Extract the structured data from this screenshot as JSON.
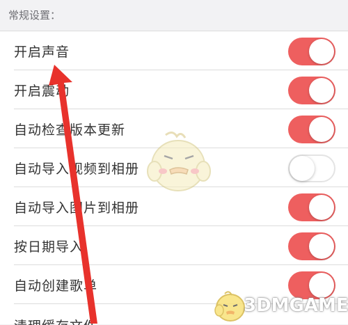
{
  "section": {
    "title": "常规设置："
  },
  "settings": [
    {
      "label": "开启声音",
      "toggle_on": true
    },
    {
      "label": "开启震动",
      "toggle_on": true
    },
    {
      "label": "自动检查版本更新",
      "toggle_on": true
    },
    {
      "label": "自动导入视频到相册",
      "toggle_on": false
    },
    {
      "label": "自动导入图片到相册",
      "toggle_on": true
    },
    {
      "label": "按日期导入",
      "toggle_on": true
    },
    {
      "label": "自动创建歌单",
      "toggle_on": true
    },
    {
      "label": "清理缓存文件",
      "toggle_on": null
    }
  ],
  "watermark": {
    "text": "3DMGAME"
  },
  "colors": {
    "toggle_on": "#ee5f5f",
    "toggle_off": "#ffffff",
    "arrow": "#e8322c"
  }
}
